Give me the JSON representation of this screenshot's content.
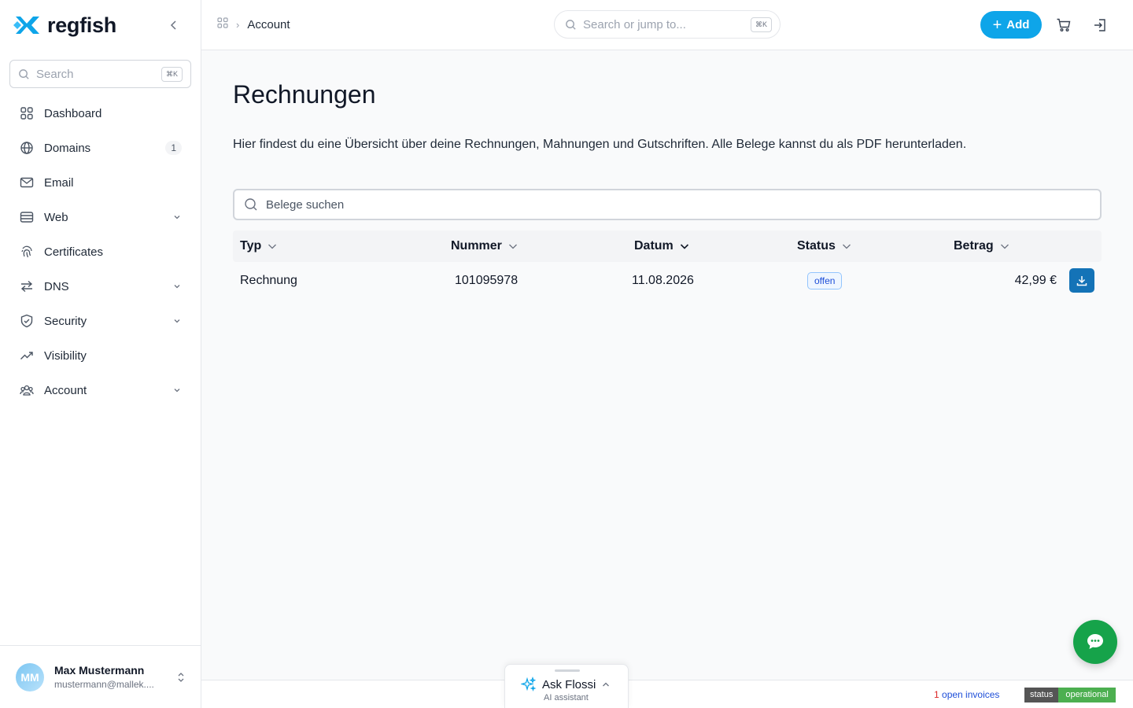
{
  "brand": {
    "name": "regfish",
    "accent": "#0ea5e9",
    "logo_icon": "regfish-x-logo"
  },
  "sidebar": {
    "search_placeholder": "Search",
    "search_shortcut": "⌘K",
    "items": [
      {
        "label": "Dashboard",
        "icon": "grid-icon"
      },
      {
        "label": "Domains",
        "icon": "globe-icon",
        "badge": "1"
      },
      {
        "label": "Email",
        "icon": "mail-icon"
      },
      {
        "label": "Web",
        "icon": "server-icon",
        "expandable": true
      },
      {
        "label": "Certificates",
        "icon": "fingerprint-icon"
      },
      {
        "label": "DNS",
        "icon": "arrows-icon",
        "expandable": true
      },
      {
        "label": "Security",
        "icon": "shield-icon",
        "expandable": true
      },
      {
        "label": "Visibility",
        "icon": "trend-icon"
      },
      {
        "label": "Account",
        "icon": "users-icon",
        "expandable": true
      }
    ],
    "user": {
      "initials": "MM",
      "name": "Max Mustermann",
      "email": "mustermann@mallek...."
    }
  },
  "topbar": {
    "breadcrumb": "Account",
    "search_placeholder": "Search or jump to...",
    "search_shortcut": "⌘K",
    "add_label": "Add"
  },
  "main": {
    "title": "Rechnungen",
    "description": "Hier findest du eine Übersicht über deine Rechnungen, Mahnungen und Gutschriften. Alle Belege kannst du als PDF herunterladen.",
    "search_placeholder": "Belege suchen",
    "table": {
      "columns": [
        "Typ",
        "Nummer",
        "Datum",
        "Status",
        "Betrag"
      ],
      "rows": [
        {
          "typ": "Rechnung",
          "nummer": "101095978",
          "datum": "11.08.2026",
          "status": "offen",
          "betrag": "42,99 €"
        }
      ]
    }
  },
  "footer": {
    "open_invoices_count": "1",
    "open_invoices_label": " open invoices",
    "status_key": "status",
    "status_value": "operational"
  },
  "assistant": {
    "title": "Ask Flossi",
    "subtitle": "AI assistant"
  }
}
